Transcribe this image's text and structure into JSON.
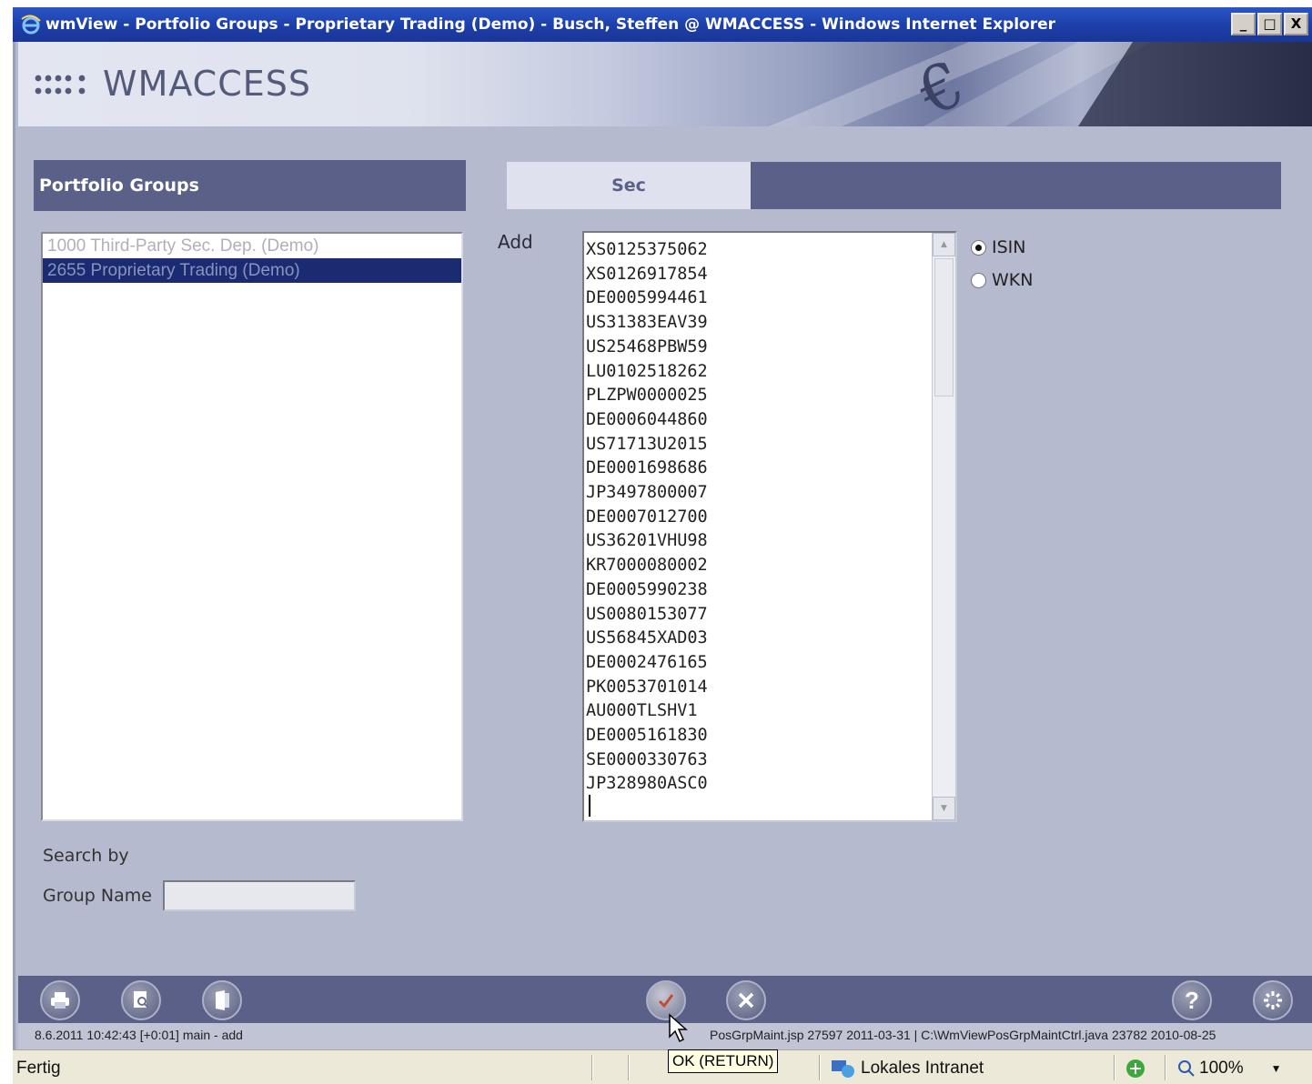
{
  "window": {
    "title": "wmView - Portfolio Groups - Proprietary Trading (Demo) - Busch, Steffen @ WMACCESS - Windows Internet Explorer",
    "buttons": [
      "_",
      "□",
      "X"
    ]
  },
  "brand": {
    "logo_text": "WMACCESS"
  },
  "portfolio_groups": {
    "header": "Portfolio Groups",
    "items": [
      {
        "label": "1000 Third-Party Sec. Dep. (Demo)",
        "selected": false
      },
      {
        "label": "2655 Proprietary Trading (Demo)",
        "selected": true
      }
    ]
  },
  "tabs": {
    "active": "Sec"
  },
  "add": {
    "label": "Add",
    "securities": [
      "XS0125375062",
      "XS0126917854",
      "DE0005994461",
      "US31383EAV39",
      "US25468PBW59",
      "LU0102518262",
      "PLZPW0000025",
      "DE0006044860",
      "US71713U2015",
      "DE0001698686",
      "JP3497800007",
      "DE0007012700",
      "US36201VHU98",
      "KR7000080002",
      "DE0005990238",
      "US0080153077",
      "US56845XAD03",
      "DE0002476165",
      "PK0053701014",
      "AU000TLSHV1",
      "DE0005161830",
      "SE0000330763",
      "JP328980ASC0"
    ],
    "id_type": {
      "options": [
        "ISIN",
        "WKN"
      ],
      "selected": "ISIN"
    }
  },
  "search": {
    "title": "Search by",
    "group_name_label": "Group Name",
    "group_name_value": ""
  },
  "toolbar": {
    "icons": [
      "print-icon",
      "preview-icon",
      "export-icon",
      "ok-icon",
      "cancel-icon",
      "help-icon",
      "settings-icon"
    ]
  },
  "status": {
    "left": "8.6.2011 10:42:43 [+0:01] main - add",
    "right": "PosGrpMaint.jsp 27597 2011-03-31  |  C:\\WmViewPosGrpMaintCtrl.java 23782 2010-08-25"
  },
  "tooltip": "OK (RETURN)",
  "ie_status": {
    "text": "Fertig",
    "zone": "Lokales Intranet",
    "zoom": "100%"
  }
}
